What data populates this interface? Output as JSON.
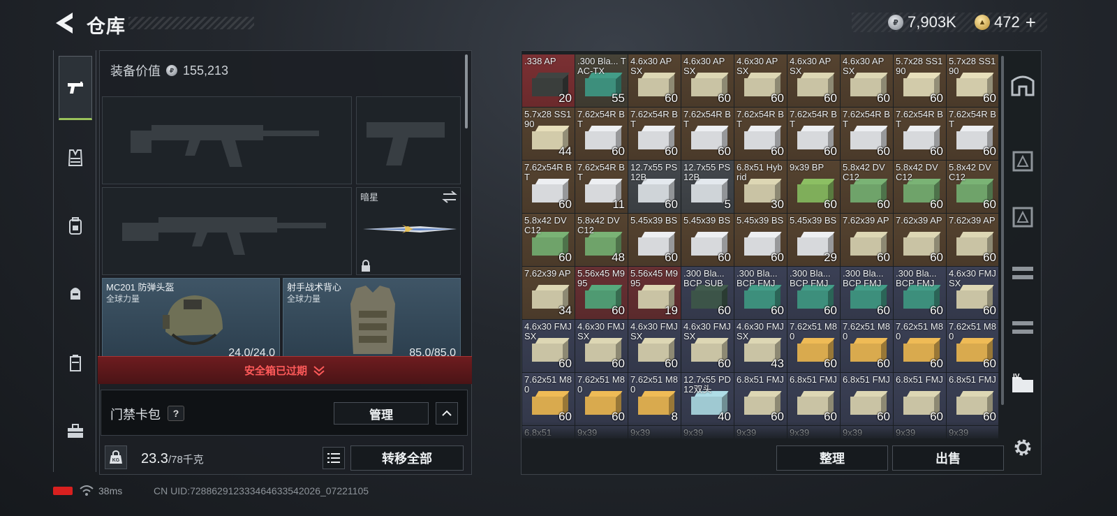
{
  "header": {
    "title": "仓库",
    "silver": "7,903K",
    "gold": "472",
    "plus": "+"
  },
  "nav": {
    "icons": [
      "pistol-icon",
      "tactical-vest-icon",
      "backpack-icon",
      "pouch-icon",
      "container-icon",
      "toolbox-icon"
    ]
  },
  "left": {
    "equip_value_label": "装备价值",
    "equip_value": "155,213",
    "knife_name": "暗星",
    "helmet": {
      "name": "MC201 防弹头盔",
      "sub": "全球力量",
      "durability": "24.0/24.0"
    },
    "vest": {
      "name": "射手战术背心",
      "sub": "全球力量",
      "durability": "85.0/85.0"
    },
    "safe_expired": "安全箱已过期",
    "keycard_label": "门禁卡包",
    "help": "?",
    "manage": "管理",
    "weight": "23.3",
    "weight_max": "/78千克",
    "kg": "KG",
    "transfer_all": "转移全部"
  },
  "status": {
    "ping": "38ms",
    "uid": "CN UID:728862912333464633542026_07221105"
  },
  "right": {
    "sort": "整理",
    "sell": "出售"
  },
  "items": [
    {
      "name": ".338 AP",
      "qty": "20",
      "bg": "#6b2a2c",
      "box": "#3a3e3c"
    },
    {
      "name": ".300 Bla... TAC-TX",
      "qty": "55",
      "bg": "#3e3a30",
      "box": "#3d8f7c"
    },
    {
      "name": "4.6x30 AP SX",
      "qty": "60",
      "bg": "#4a3a2a",
      "box": "#c9c3a4"
    },
    {
      "name": "4.6x30 AP SX",
      "qty": "60",
      "bg": "#4a3a2a",
      "box": "#c9c3a4"
    },
    {
      "name": "4.6x30 AP SX",
      "qty": "60",
      "bg": "#4a3a2a",
      "box": "#c9c3a4"
    },
    {
      "name": "4.6x30 AP SX",
      "qty": "60",
      "bg": "#4a3a2a",
      "box": "#c9c3a4"
    },
    {
      "name": "4.6x30 AP SX",
      "qty": "60",
      "bg": "#4a3a2a",
      "box": "#c9c3a4"
    },
    {
      "name": "5.7x28 SS190",
      "qty": "60",
      "bg": "#4a3a2a",
      "box": "#d2cbaa"
    },
    {
      "name": "5.7x28 SS190",
      "qty": "60",
      "bg": "#4a3a2a",
      "box": "#d2cbaa"
    },
    {
      "name": "5.7x28 SS190",
      "qty": "44",
      "bg": "#4a3a2a",
      "box": "#d2cbaa"
    },
    {
      "name": "7.62x54R BT",
      "qty": "60",
      "bg": "#4a3a2a",
      "box": "#d7d9dc"
    },
    {
      "name": "7.62x54R BT",
      "qty": "60",
      "bg": "#4a3a2a",
      "box": "#d7d9dc"
    },
    {
      "name": "7.62x54R BT",
      "qty": "60",
      "bg": "#4a3a2a",
      "box": "#d7d9dc"
    },
    {
      "name": "7.62x54R BT",
      "qty": "60",
      "bg": "#4a3a2a",
      "box": "#d7d9dc"
    },
    {
      "name": "7.62x54R BT",
      "qty": "60",
      "bg": "#4a3a2a",
      "box": "#d7d9dc"
    },
    {
      "name": "7.62x54R BT",
      "qty": "60",
      "bg": "#4a3a2a",
      "box": "#d7d9dc"
    },
    {
      "name": "7.62x54R BT",
      "qty": "60",
      "bg": "#4a3a2a",
      "box": "#d7d9dc"
    },
    {
      "name": "7.62x54R BT",
      "qty": "60",
      "bg": "#4a3a2a",
      "box": "#d7d9dc"
    },
    {
      "name": "7.62x54R BT",
      "qty": "60",
      "bg": "#4a3a2a",
      "box": "#d7d9dc"
    },
    {
      "name": "7.62x54R BT",
      "qty": "11",
      "bg": "#4a3a2a",
      "box": "#d7d9dc"
    },
    {
      "name": "12.7x55 PS12B",
      "qty": "60",
      "bg": "#3a3e42",
      "box": "#cfd4d8"
    },
    {
      "name": "12.7x55 PS12B",
      "qty": "5",
      "bg": "#3a3e42",
      "box": "#cfd4d8"
    },
    {
      "name": "6.8x51 Hybrid",
      "qty": "30",
      "bg": "#4a3a2a",
      "box": "#c9c3a4"
    },
    {
      "name": "9x39 BP",
      "qty": "60",
      "bg": "#4a3a2a",
      "box": "#7fae5a"
    },
    {
      "name": "5.8x42 DVC12",
      "qty": "60",
      "bg": "#4a3a2a",
      "box": "#6fa36a"
    },
    {
      "name": "5.8x42 DVC12",
      "qty": "60",
      "bg": "#4a3a2a",
      "box": "#6fa36a"
    },
    {
      "name": "5.8x42 DVC12",
      "qty": "60",
      "bg": "#4a3a2a",
      "box": "#6fa36a"
    },
    {
      "name": "5.8x42 DVC12",
      "qty": "60",
      "bg": "#4a3a2a",
      "box": "#6fa36a"
    },
    {
      "name": "5.8x42 DVC12",
      "qty": "48",
      "bg": "#4a3a2a",
      "box": "#6fa36a"
    },
    {
      "name": "5.45x39 BS",
      "qty": "60",
      "bg": "#4a3a2a",
      "box": "#d7d9dc"
    },
    {
      "name": "5.45x39 BS",
      "qty": "60",
      "bg": "#4a3a2a",
      "box": "#d7d9dc"
    },
    {
      "name": "5.45x39 BS",
      "qty": "60",
      "bg": "#4a3a2a",
      "box": "#d7d9dc"
    },
    {
      "name": "5.45x39 BS",
      "qty": "29",
      "bg": "#4a3a2a",
      "box": "#d7d9dc"
    },
    {
      "name": "7.62x39 AP",
      "qty": "60",
      "bg": "#4a3a2a",
      "box": "#c9c3a4"
    },
    {
      "name": "7.62x39 AP",
      "qty": "60",
      "bg": "#4a3a2a",
      "box": "#c9c3a4"
    },
    {
      "name": "7.62x39 AP",
      "qty": "60",
      "bg": "#4a3a2a",
      "box": "#c9c3a4"
    },
    {
      "name": "7.62x39 AP",
      "qty": "34",
      "bg": "#4a3a2a",
      "box": "#c9c3a4"
    },
    {
      "name": "5.56x45 M995",
      "qty": "60",
      "bg": "#5a2a2c",
      "box": "#4f9a72"
    },
    {
      "name": "5.56x45 M995",
      "qty": "19",
      "bg": "#5a2a2c",
      "box": "#c9c3a4"
    },
    {
      "name": ".300 Bla... BCP SUB",
      "qty": "60",
      "bg": "#33384a",
      "box": "#3c5448"
    },
    {
      "name": ".300 Bla... BCP FMJ",
      "qty": "60",
      "bg": "#33384a",
      "box": "#3d8f7c"
    },
    {
      "name": ".300 Bla... BCP FMJ",
      "qty": "60",
      "bg": "#33384a",
      "box": "#3d8f7c"
    },
    {
      "name": ".300 Bla... BCP FMJ",
      "qty": "60",
      "bg": "#33384a",
      "box": "#3d8f7c"
    },
    {
      "name": ".300 Bla... BCP FMJ",
      "qty": "60",
      "bg": "#33384a",
      "box": "#3d8f7c"
    },
    {
      "name": "4.6x30 FMJ SX",
      "qty": "60",
      "bg": "#33384a",
      "box": "#c9c3a4"
    },
    {
      "name": "4.6x30 FMJ SX",
      "qty": "60",
      "bg": "#33384a",
      "box": "#c9c3a4"
    },
    {
      "name": "4.6x30 FMJ SX",
      "qty": "60",
      "bg": "#33384a",
      "box": "#c9c3a4"
    },
    {
      "name": "4.6x30 FMJ SX",
      "qty": "60",
      "bg": "#33384a",
      "box": "#c9c3a4"
    },
    {
      "name": "4.6x30 FMJ SX",
      "qty": "60",
      "bg": "#33384a",
      "box": "#c9c3a4"
    },
    {
      "name": "4.6x30 FMJ SX",
      "qty": "43",
      "bg": "#33384a",
      "box": "#c9c3a4"
    },
    {
      "name": "7.62x51 M80",
      "qty": "60",
      "bg": "#33384a",
      "box": "#d9aa4e"
    },
    {
      "name": "7.62x51 M80",
      "qty": "60",
      "bg": "#33384a",
      "box": "#d9aa4e"
    },
    {
      "name": "7.62x51 M80",
      "qty": "60",
      "bg": "#33384a",
      "box": "#d9aa4e"
    },
    {
      "name": "7.62x51 M80",
      "qty": "60",
      "bg": "#33384a",
      "box": "#d9aa4e"
    },
    {
      "name": "7.62x51 M80",
      "qty": "60",
      "bg": "#33384a",
      "box": "#d9aa4e"
    },
    {
      "name": "7.62x51 M80",
      "qty": "60",
      "bg": "#33384a",
      "box": "#d9aa4e"
    },
    {
      "name": "7.62x51 M80",
      "qty": "8",
      "bg": "#33384a",
      "box": "#d9aa4e"
    },
    {
      "name": "12.7x55 PD12双头",
      "qty": "40",
      "bg": "#33384a",
      "box": "#9fc9d2"
    },
    {
      "name": "6.8x51 FMJ",
      "qty": "60",
      "bg": "#33384a",
      "box": "#c9c3a4"
    },
    {
      "name": "6.8x51 FMJ",
      "qty": "60",
      "bg": "#33384a",
      "box": "#c9c3a4"
    },
    {
      "name": "6.8x51 FMJ",
      "qty": "60",
      "bg": "#33384a",
      "box": "#c9c3a4"
    },
    {
      "name": "6.8x51 FMJ",
      "qty": "60",
      "bg": "#33384a",
      "box": "#c9c3a4"
    },
    {
      "name": "6.8x51 FMJ",
      "qty": "60",
      "bg": "#33384a",
      "box": "#c9c3a4"
    },
    {
      "name": "6.8x51",
      "qty": "",
      "bg": "#33384a",
      "box": "#c9c3a4"
    },
    {
      "name": "9x39",
      "qty": "",
      "bg": "#33384a",
      "box": "#c9c3a4"
    },
    {
      "name": "9x39",
      "qty": "",
      "bg": "#33384a",
      "box": "#c9c3a4"
    },
    {
      "name": "9x39",
      "qty": "",
      "bg": "#33384a",
      "box": "#c9c3a4"
    },
    {
      "name": "9x39",
      "qty": "",
      "bg": "#33384a",
      "box": "#c9c3a4"
    },
    {
      "name": "9x39",
      "qty": "",
      "bg": "#33384a",
      "box": "#c9c3a4"
    },
    {
      "name": "9x39",
      "qty": "",
      "bg": "#33384a",
      "box": "#c9c3a4"
    },
    {
      "name": "9x39",
      "qty": "",
      "bg": "#33384a",
      "box": "#c9c3a4"
    },
    {
      "name": "9x39",
      "qty": "",
      "bg": "#33384a",
      "box": "#c9c3a4"
    }
  ]
}
